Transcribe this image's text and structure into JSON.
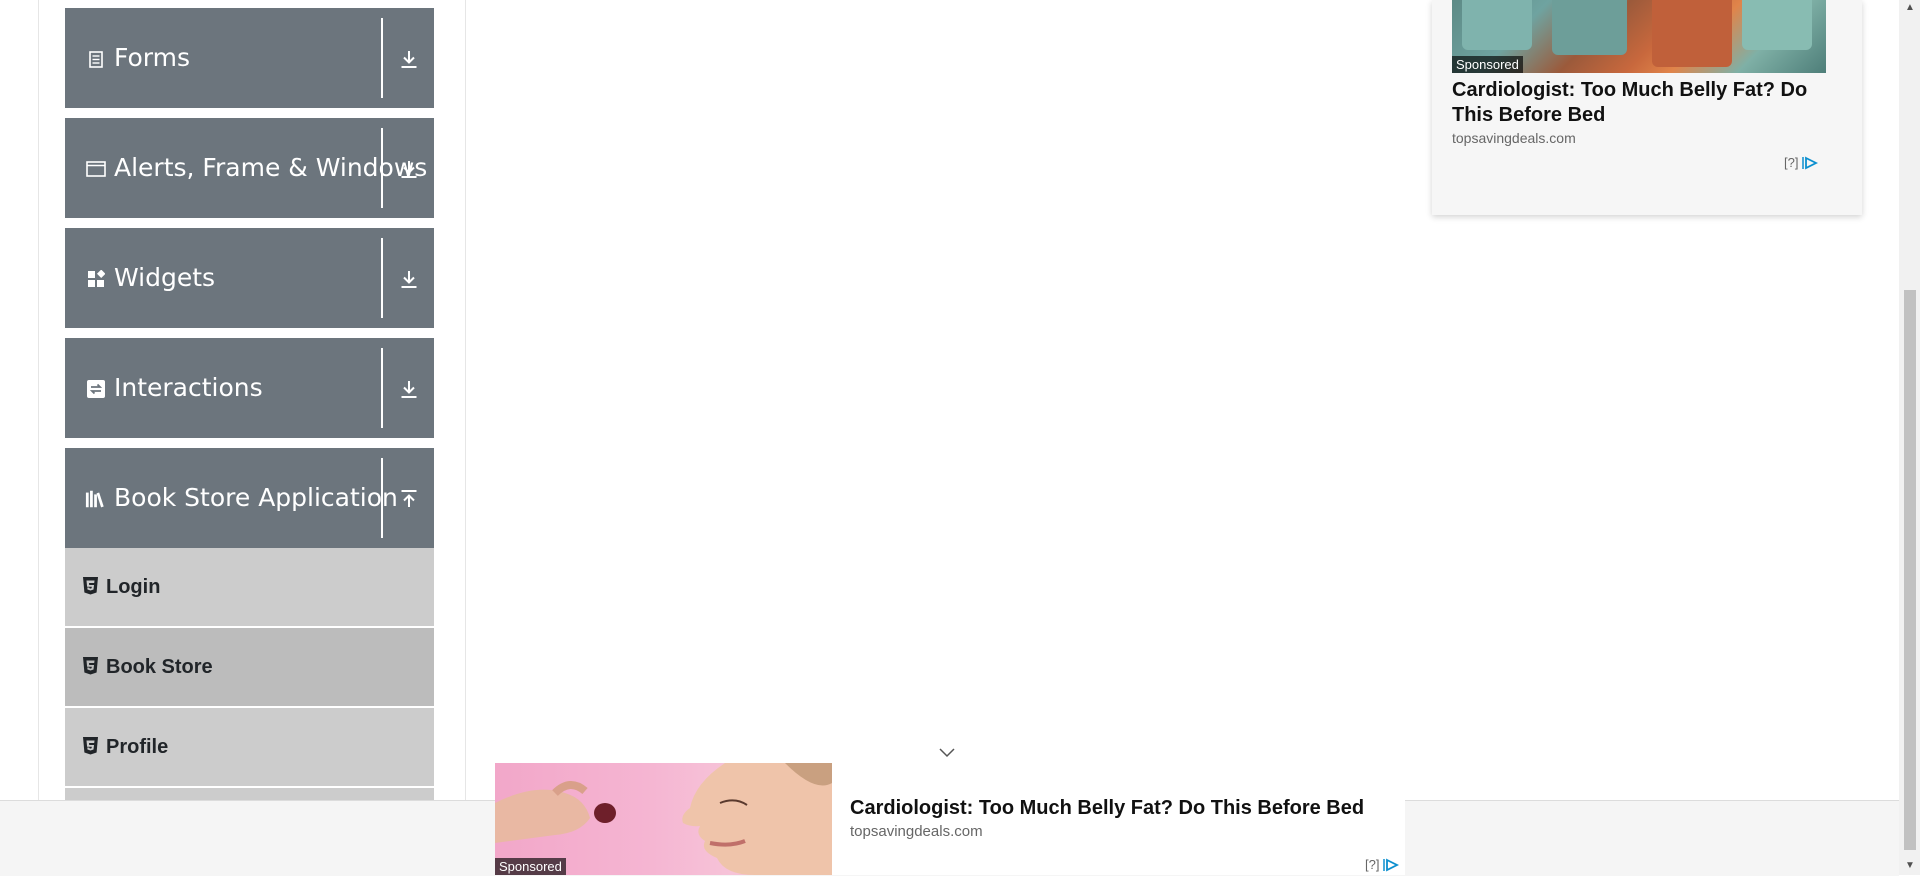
{
  "menu": {
    "groups": [
      {
        "title": "Forms",
        "icon": "document-icon",
        "state": "collapsed"
      },
      {
        "title": "Alerts, Frame & Windows",
        "icon": "window-icon",
        "state": "collapsed"
      },
      {
        "title": "Widgets",
        "icon": "widgets-icon",
        "state": "collapsed"
      },
      {
        "title": "Interactions",
        "icon": "interactions-icon",
        "state": "collapsed"
      },
      {
        "title": "Book Store Application",
        "icon": "books-icon",
        "state": "expanded"
      }
    ],
    "book_store_items": [
      {
        "label": "Login",
        "icon": "html5-icon"
      },
      {
        "label": "Book Store",
        "icon": "html5-icon"
      },
      {
        "label": "Profile",
        "icon": "html5-icon"
      }
    ]
  },
  "ad_right": {
    "sponsored": "Sponsored",
    "title": "Cardiologist: Too Much Belly Fat? Do This Before Bed",
    "domain": "topsavingdeals.com",
    "adchoice": "[?]"
  },
  "ad_bottom": {
    "sponsored": "Sponsored",
    "title": "Cardiologist: Too Much Belly Fat? Do This Before Bed",
    "domain": "topsavingdeals.com",
    "adchoice": "[?]"
  },
  "colors": {
    "menu_header_bg": "#6c757d",
    "menu_item_bg": "#cccccc",
    "menu_item_active_bg": "#bcbcbc",
    "adchoice_blue": "#0b8fcf"
  }
}
